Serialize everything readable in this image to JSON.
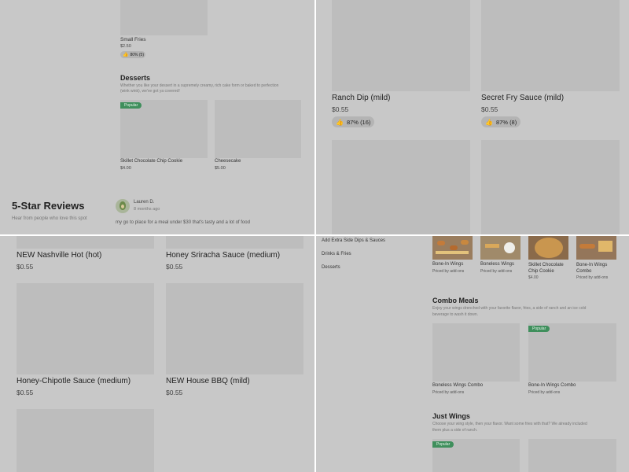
{
  "q1": {
    "small_fries": {
      "name": "Small Fries",
      "price": "$2.50",
      "rating": "80% (5)"
    },
    "desserts": {
      "title": "Desserts",
      "desc_line1": "Whether you like your dessert in a supremely creamy, rich cake form or baked to perfection",
      "desc_line2": "(wink wink), we've got ya covered!",
      "badge": "Popular",
      "items": [
        {
          "name": "Skillet Chocolate Chip Cookie",
          "price": "$4.00"
        },
        {
          "name": "Cheesecake",
          "price": "$5.00"
        }
      ]
    },
    "reviews": {
      "title": "5-Star Reviews",
      "subtitle": "Hear from people who love this spot",
      "reviewer": "Lauren D.",
      "time": "8 months ago",
      "text": "my go to place for a meal under $30 that's tasty and a lot of food"
    }
  },
  "q2": {
    "items": [
      {
        "name": "Ranch Dip (mild)",
        "price": "$0.55",
        "rating": "87% (16)"
      },
      {
        "name": "Secret Fry Sauce (mild)",
        "price": "$0.55",
        "rating": "87% (8)"
      }
    ]
  },
  "q3": {
    "items": [
      {
        "name": "NEW Nashville Hot (hot)",
        "price": "$0.55"
      },
      {
        "name": "Honey Sriracha Sauce (medium)",
        "price": "$0.55"
      },
      {
        "name": "Honey-Chipotle Sauce (medium)",
        "price": "$0.55"
      },
      {
        "name": "NEW House BBQ (mild)",
        "price": "$0.55"
      }
    ]
  },
  "q4": {
    "nav": [
      "Add Extra Side Dips & Sauces",
      "Drinks & Fries",
      "Desserts"
    ],
    "featured": [
      {
        "name": "Bone-In Wings",
        "price": "Priced by add-ons"
      },
      {
        "name": "Boneless Wings",
        "price": "Priced by add-ons"
      },
      {
        "name": "Skillet Chocolate Chip Cookie",
        "price": "$4.00"
      },
      {
        "name": "Bone-In Wings Combo",
        "price": "Priced by add-ons"
      }
    ],
    "combo": {
      "title": "Combo Meals",
      "desc_line1": "Enjoy your wings drenched with your favorite flavor, fries, a side of ranch and an ice cold",
      "desc_line2": "beverage to wash it down.",
      "badge": "Popular",
      "items": [
        {
          "name": "Boneless Wings Combo",
          "price": "Priced by add-ons"
        },
        {
          "name": "Bone-In Wings Combo",
          "price": "Priced by add-ons"
        }
      ]
    },
    "just": {
      "title": "Just Wings",
      "desc_line1": "Choose your wing style, then your flavor. Want some fries with that? We already included",
      "desc_line2": "them plus a side of ranch.",
      "badge": "Popular"
    }
  }
}
